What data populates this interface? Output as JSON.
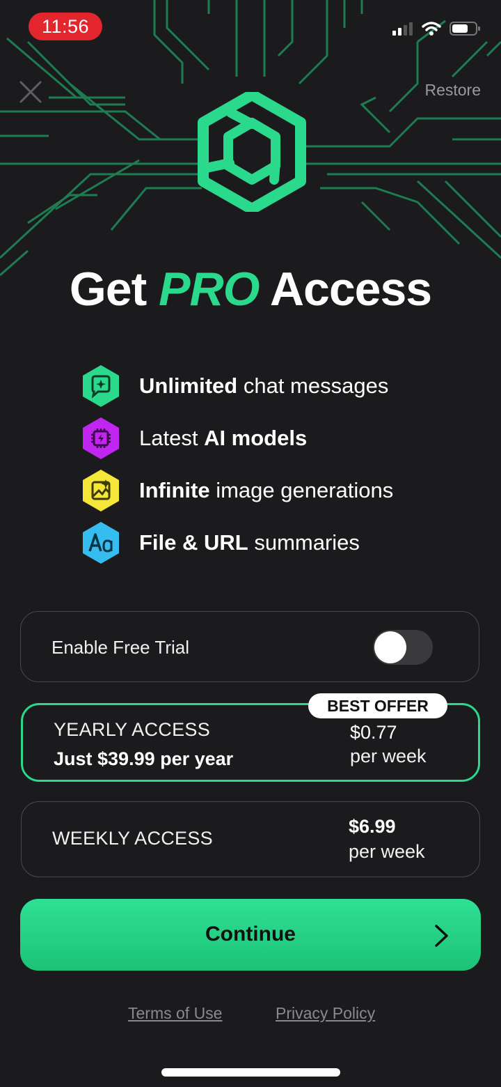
{
  "status_bar": {
    "time": "11:56"
  },
  "header": {
    "restore_label": "Restore"
  },
  "headline": {
    "prefix": "Get",
    "highlight": "PRO",
    "suffix": "Access"
  },
  "features": [
    {
      "bold": "Unlimited",
      "rest": " chat messages",
      "icon": "sparkle-chat-icon",
      "color": "#2bd98c"
    },
    {
      "plain": "Latest ",
      "bold": "AI models",
      "icon": "chip-icon",
      "color": "#c026f0"
    },
    {
      "bold": "Infinite",
      "rest": " image generations",
      "icon": "image-sparkle-icon",
      "color": "#f5e63a"
    },
    {
      "bold": "File & URL",
      "rest": " summaries",
      "icon": "text-aa-icon",
      "color": "#35bdf0"
    }
  ],
  "trial": {
    "label": "Enable Free Trial",
    "enabled": false
  },
  "plans": {
    "yearly": {
      "badge": "BEST OFFER",
      "name": "YEARLY ACCESS",
      "subtitle": "Just $39.99 per year",
      "price": "$0.77",
      "period": "per week",
      "selected": true
    },
    "weekly": {
      "name": "WEEKLY ACCESS",
      "price": "$6.99",
      "period": "per week",
      "selected": false
    }
  },
  "cta": {
    "label": "Continue"
  },
  "footer": {
    "terms": "Terms of Use",
    "privacy": "Privacy Policy"
  },
  "colors": {
    "accent": "#2bd98c",
    "background": "#1b1b1d"
  }
}
